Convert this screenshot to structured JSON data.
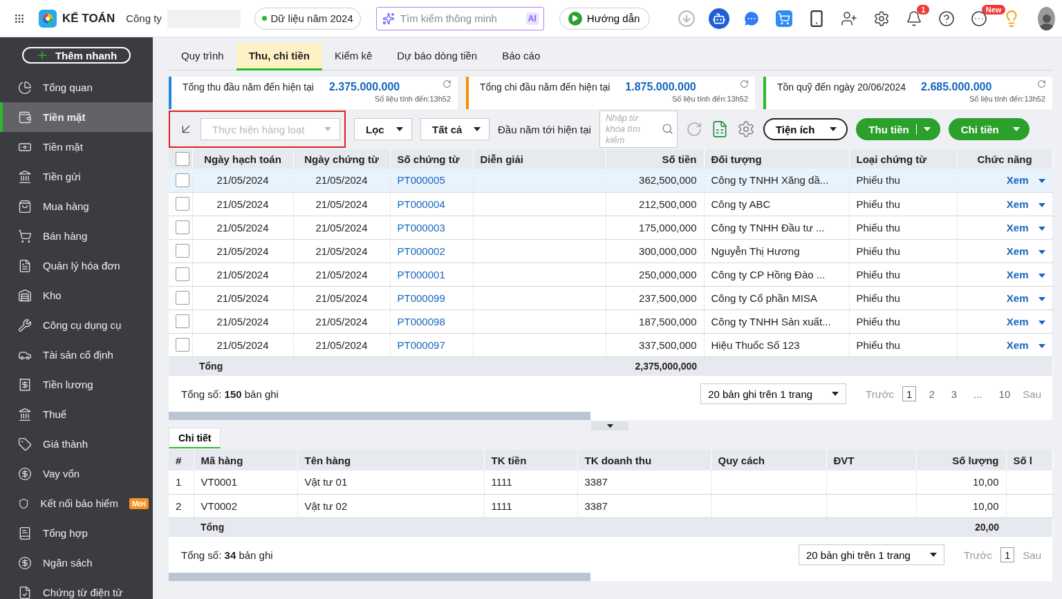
{
  "topbar": {
    "brand": "KẾ TOÁN",
    "company_label": "Công ty",
    "year_chip": "Dữ liệu năm 2024",
    "search": {
      "placeholder": "Tìm kiếm thông minh",
      "badge": "AI"
    },
    "guide_button": "Hướng dẫn",
    "notification_count": "1",
    "new_badge": "New"
  },
  "sidebar": {
    "quick_add": "Thêm nhanh",
    "items": [
      {
        "label": "Tổng quan",
        "selected": false
      },
      {
        "label": "Tiền mặt",
        "selected": true
      },
      {
        "label": "Tiền mặt",
        "selected": false
      },
      {
        "label": "Tiền gửi",
        "selected": false
      },
      {
        "label": "Mua hàng",
        "selected": false
      },
      {
        "label": "Bán hàng",
        "selected": false
      },
      {
        "label": "Quản lý hóa đơn",
        "selected": false
      },
      {
        "label": "Kho",
        "selected": false
      },
      {
        "label": "Công cụ dụng cụ",
        "selected": false
      },
      {
        "label": "Tài sản cố định",
        "selected": false
      },
      {
        "label": "Tiền lương",
        "selected": false
      },
      {
        "label": "Thuế",
        "selected": false
      },
      {
        "label": "Giá thành",
        "selected": false
      },
      {
        "label": "Vay vốn",
        "selected": false
      },
      {
        "label": "Kết nối bảo hiểm",
        "selected": false,
        "badge": "Mới"
      },
      {
        "label": "Tổng hợp",
        "selected": false
      },
      {
        "label": "Ngân sách",
        "selected": false
      },
      {
        "label": "Chứng từ điện tử",
        "selected": false
      }
    ]
  },
  "tabs": [
    {
      "label": "Quy trình",
      "selected": false
    },
    {
      "label": "Thu, chi tiền",
      "selected": true
    },
    {
      "label": "Kiểm kê",
      "selected": false
    },
    {
      "label": "Dự báo dòng tiền",
      "selected": false
    },
    {
      "label": "Báo cáo",
      "selected": false
    }
  ],
  "summary_cards": [
    {
      "label": "Tổng thu đầu năm đến hiện tại",
      "amount": "2.375.000.000",
      "note": "Số liệu tính đến:13h52",
      "color": "#1e88e5"
    },
    {
      "label": "Tổng chi đầu năm đến hiện tại",
      "amount": "1.875.000.000",
      "note": "Số liệu tính đến:13h52",
      "color": "#fb8c00"
    },
    {
      "label": "Tồn quỹ đến ngày 20/06/2024",
      "amount": "2.685.000.000",
      "note": "Số liệu tính đến:13h52",
      "color": "#2eb82e"
    }
  ],
  "toolbar": {
    "bulk_action": {
      "placeholder": "Thực hiện hàng loạt",
      "disabled": true
    },
    "filter": "Lọc",
    "scope": "Tất cả",
    "period": "Đầu năm tới hiện tại",
    "search_placeholder": "Nhập từ khóa tìm kiếm",
    "utilities": "Tiện ích",
    "receive": "Thu tiền",
    "pay": "Chi tiền"
  },
  "table": {
    "all_checked": false,
    "columns": [
      "Ngày hạch toán",
      "Ngày chứng từ",
      "Số chứng từ",
      "Diễn giải",
      "Số tiền",
      "Đối tượng",
      "Loại chứng từ",
      "Chức năng"
    ],
    "rows": [
      {
        "selected": true,
        "checked": false,
        "posting_date": "21/05/2024",
        "doc_date": "21/05/2024",
        "doc_no": "PT000005",
        "amount": "362,500,000",
        "party": "Công ty TNHH Xăng dầ...",
        "doc_type": "Phiếu thu",
        "action": "Xem"
      },
      {
        "selected": false,
        "checked": false,
        "posting_date": "21/05/2024",
        "doc_date": "21/05/2024",
        "doc_no": "PT000004",
        "amount": "212,500,000",
        "party": "Công ty ABC",
        "doc_type": "Phiếu thu",
        "action": "Xem"
      },
      {
        "selected": false,
        "checked": false,
        "posting_date": "21/05/2024",
        "doc_date": "21/05/2024",
        "doc_no": "PT000003",
        "amount": "175,000,000",
        "party": "Công ty TNHH Đầu tư ...",
        "doc_type": "Phiếu thu",
        "action": "Xem"
      },
      {
        "selected": false,
        "checked": false,
        "posting_date": "21/05/2024",
        "doc_date": "21/05/2024",
        "doc_no": "PT000002",
        "amount": "300,000,000",
        "party": "Nguyễn Thị Hương",
        "doc_type": "Phiếu thu",
        "action": "Xem"
      },
      {
        "selected": false,
        "checked": false,
        "posting_date": "21/05/2024",
        "doc_date": "21/05/2024",
        "doc_no": "PT000001",
        "amount": "250,000,000",
        "party": "Công ty CP Hồng Đào ...",
        "doc_type": "Phiếu thu",
        "action": "Xem"
      },
      {
        "selected": false,
        "checked": false,
        "posting_date": "21/05/2024",
        "doc_date": "21/05/2024",
        "doc_no": "PT000099",
        "amount": "237,500,000",
        "party": "Công ty Cổ phần MISA",
        "doc_type": "Phiếu thu",
        "action": "Xem"
      },
      {
        "selected": false,
        "checked": false,
        "posting_date": "21/05/2024",
        "doc_date": "21/05/2024",
        "doc_no": "PT000098",
        "amount": "187,500,000",
        "party": "Công ty TNHH Sản xuất...",
        "doc_type": "Phiếu thu",
        "action": "Xem"
      },
      {
        "selected": false,
        "checked": false,
        "posting_date": "21/05/2024",
        "doc_date": "21/05/2024",
        "doc_no": "PT000097",
        "amount": "337,500,000",
        "party": "Hiệu Thuốc Số 123",
        "doc_type": "Phiếu thu",
        "action": "Xem"
      }
    ],
    "totals": {
      "label": "Tổng",
      "amount": "2,375,000,000"
    },
    "footer": {
      "total_label": "Tổng số:",
      "count": "150",
      "unit": "bản ghi"
    },
    "pagination": {
      "page_size": "20 bản ghi trên 1 trang",
      "prev": "Trước",
      "next": "Sau",
      "pages": [
        {
          "label": "1",
          "selected": true
        },
        {
          "label": "2",
          "selected": false
        },
        {
          "label": "3",
          "selected": false
        },
        {
          "label": "...",
          "selected": false
        },
        {
          "label": "10",
          "selected": false
        }
      ]
    }
  },
  "detail": {
    "tabs": [
      {
        "label": "Chi tiết",
        "selected": true
      }
    ],
    "columns": [
      "#",
      "Mã hàng",
      "Tên hàng",
      "TK tiền",
      "TK doanh thu",
      "Quy cách",
      "ĐVT",
      "Số lượng",
      "Số l"
    ],
    "rows": [
      {
        "no": "1",
        "code": "VT0001",
        "name": "Vật tư 01",
        "cash_account": "1111",
        "revenue_account": "3387",
        "quantity": "10,00"
      },
      {
        "no": "2",
        "code": "VT0002",
        "name": "Vật tư 02",
        "cash_account": "1111",
        "revenue_account": "3387",
        "quantity": "10,00"
      }
    ],
    "totals": {
      "label": "Tổng",
      "quantity": "20,00"
    },
    "footer": {
      "total_label": "Tổng số:",
      "count": "34",
      "unit": "bản ghi"
    },
    "pagination": {
      "page_size": "20 bản ghi trên 1 trang",
      "prev": "Trước",
      "next": "Sau",
      "pages": [
        {
          "label": "1",
          "selected": true
        }
      ]
    }
  }
}
